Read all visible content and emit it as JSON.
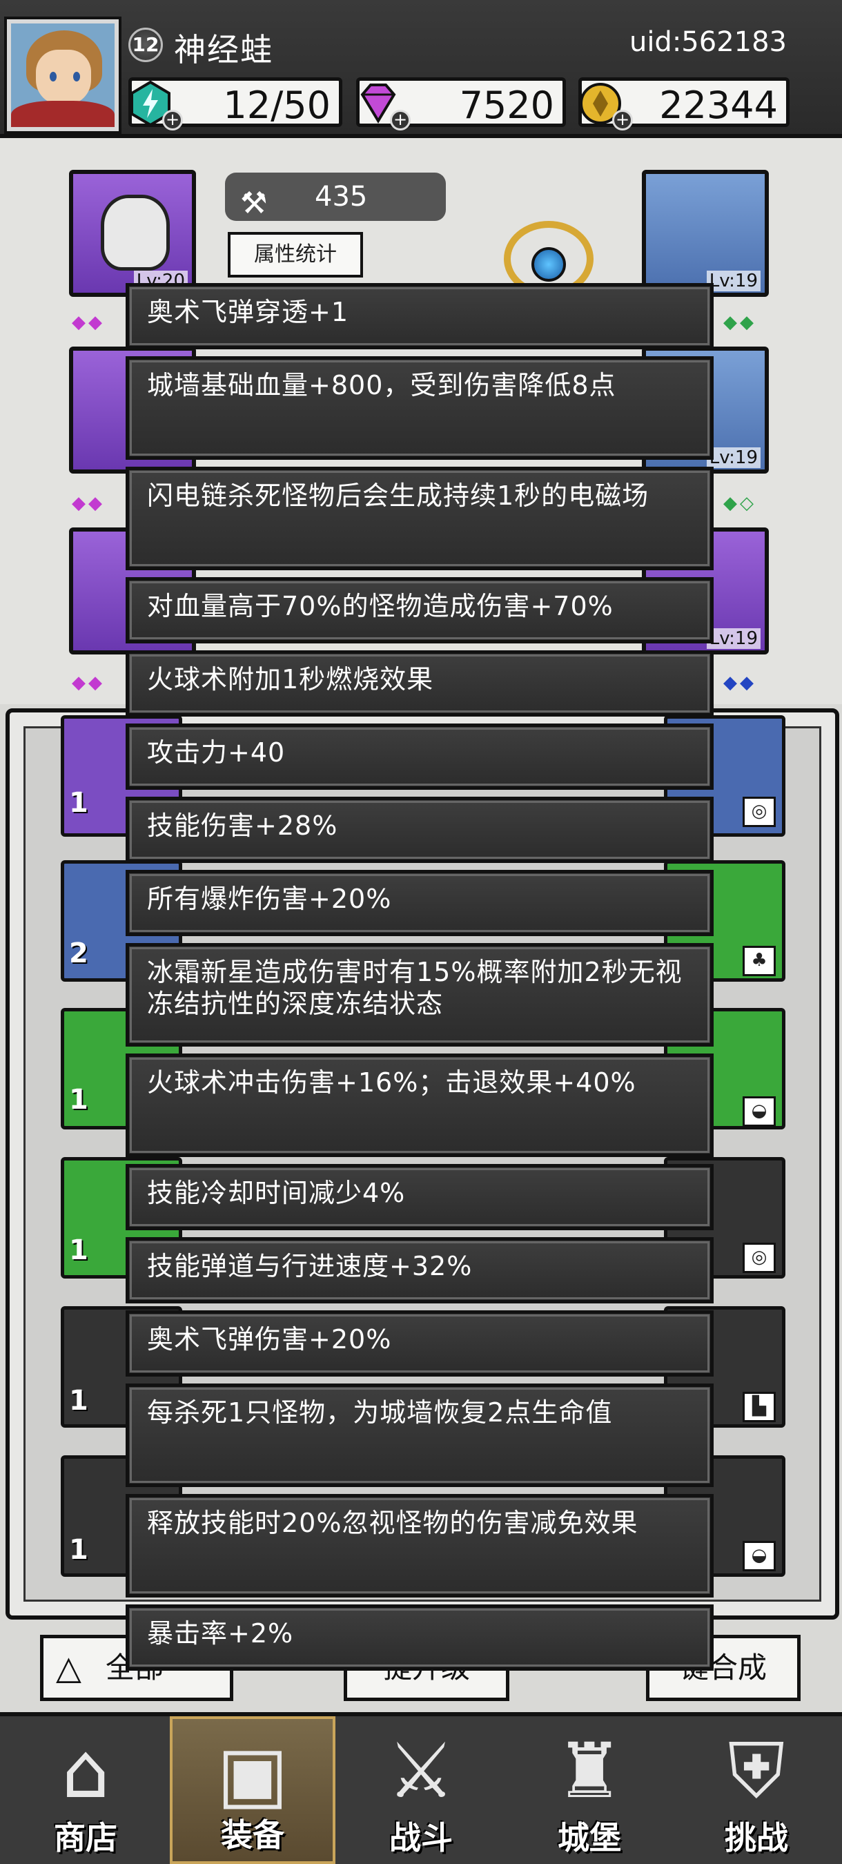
{
  "header": {
    "level": "12",
    "player_name": "神经蛙",
    "uid": "uid:562183",
    "energy": "12/50",
    "gems": "7520",
    "gold": "22344"
  },
  "equipment": {
    "power": "435",
    "stats_button": "属性统计",
    "slots": [
      {
        "lv": "Lv:20"
      },
      {
        "lv": "Lv:19"
      },
      {
        "lv": "Lv:19"
      },
      {
        "lv": "Lv:19"
      }
    ]
  },
  "inventory": {
    "counts": [
      "1",
      "2",
      "1",
      "1",
      "1",
      "1"
    ]
  },
  "bottom_buttons": {
    "filter": "全部",
    "upgrade": "提升级",
    "merge": "键合成"
  },
  "tooltip_lines": [
    "奥术飞弹穿透+1",
    "城墙基础血量+800，受到伤害降低8点",
    "闪电链杀死怪物后会生成持续1秒的电磁场",
    "对血量高于70%的怪物造成伤害+70%",
    "火球术附加1秒燃烧效果",
    "攻击力+40",
    "技能伤害+28%",
    "所有爆炸伤害+20%",
    "冰霜新星造成伤害时有15%概率附加2秒无视冻结抗性的深度冻结状态",
    "火球术冲击伤害+16%；击退效果+40%",
    "技能冷却时间减少4%",
    "技能弹道与行进速度+32%",
    "奥术飞弹伤害+20%",
    "每杀死1只怪物，为城墙恢复2点生命值",
    "释放技能时20%忽视怪物的伤害减免效果",
    "暴击率+2%"
  ],
  "nav": [
    {
      "label": "商店",
      "icon": "shop-icon"
    },
    {
      "label": "装备",
      "icon": "backpack-icon"
    },
    {
      "label": "战斗",
      "icon": "swords-icon"
    },
    {
      "label": "城堡",
      "icon": "castle-icon"
    },
    {
      "label": "挑战",
      "icon": "lock-icon"
    }
  ],
  "colors": {
    "tooltip_bg": "#333333",
    "active_tab": "#6a5a3c",
    "purple_slot": "#8050c4",
    "blue_slot": "#6284c2",
    "green_item": "#3aa83a"
  }
}
